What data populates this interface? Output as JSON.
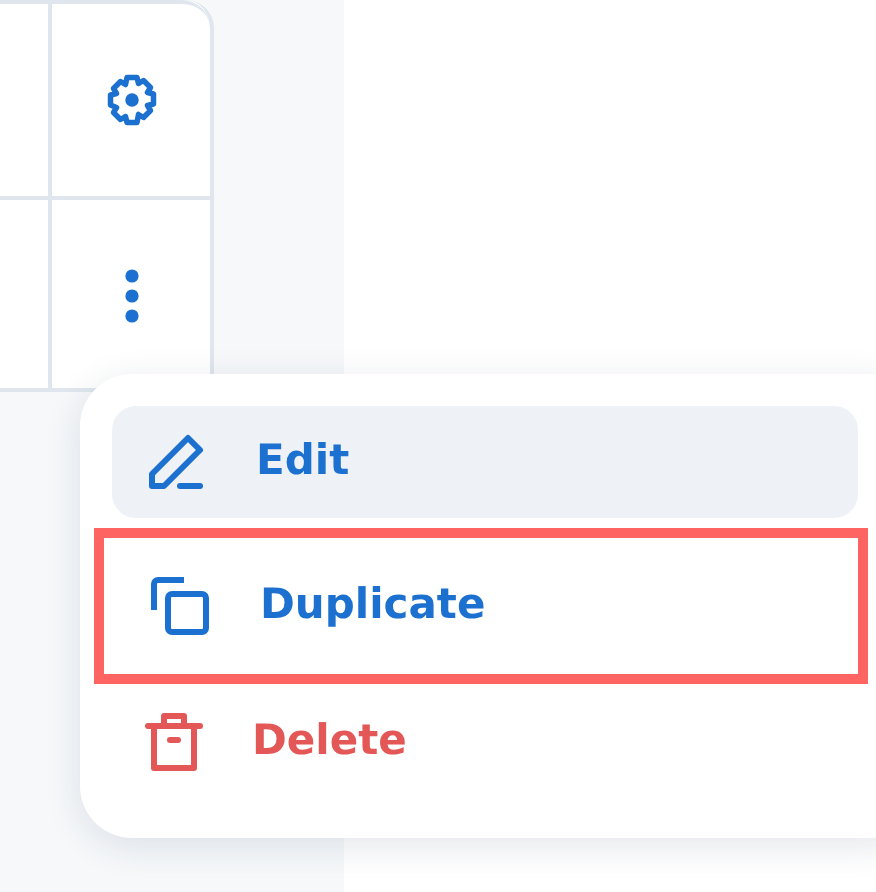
{
  "table": {
    "rows": [
      {
        "kind": "settings"
      },
      {
        "kind": "more"
      }
    ]
  },
  "menu": {
    "items": [
      {
        "label": "Edit",
        "kind": "edit",
        "hovered": true,
        "outlined": false
      },
      {
        "label": "Duplicate",
        "kind": "duplicate",
        "hovered": false,
        "outlined": true
      },
      {
        "label": "Delete",
        "kind": "delete",
        "hovered": false,
        "outlined": false
      }
    ]
  }
}
